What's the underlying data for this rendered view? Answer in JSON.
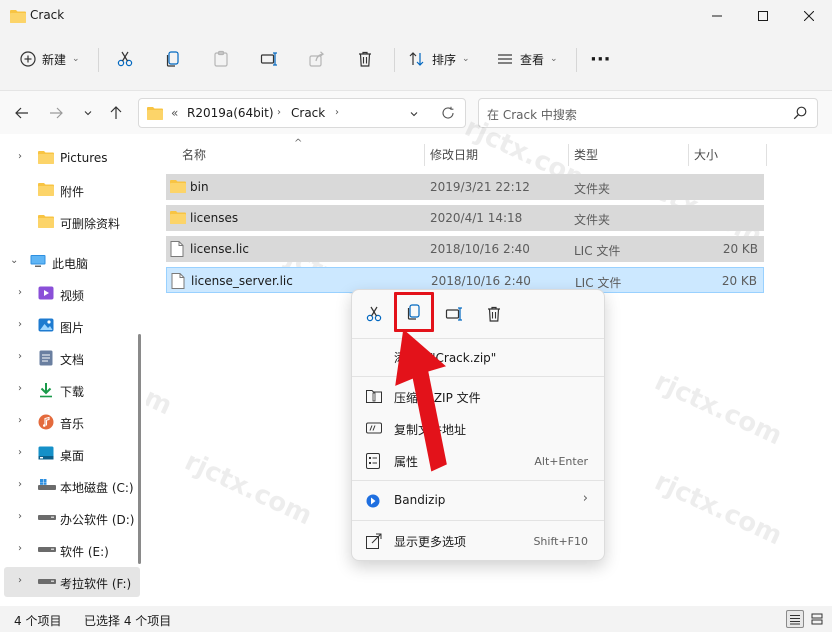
{
  "window": {
    "title": "Crack"
  },
  "command_bar": {
    "new_label": "新建",
    "sort_label": "排序",
    "view_label": "查看",
    "more_label": "···"
  },
  "address": {
    "overflow": "«",
    "crumbs": [
      "R2019a(64bit)",
      "Crack"
    ],
    "search_placeholder": "在 Crack 中搜索"
  },
  "sidebar": {
    "items": [
      {
        "label": "Pictures"
      },
      {
        "label": "附件"
      },
      {
        "label": "可删除资料"
      },
      {
        "label": "此电脑"
      },
      {
        "label": "视频"
      },
      {
        "label": "图片"
      },
      {
        "label": "文档"
      },
      {
        "label": "下载"
      },
      {
        "label": "音乐"
      },
      {
        "label": "桌面"
      },
      {
        "label": "本地磁盘 (C:)"
      },
      {
        "label": "办公软件 (D:)"
      },
      {
        "label": "软件 (E:)"
      },
      {
        "label": "考拉软件 (F:)"
      }
    ]
  },
  "columns": {
    "name": "名称",
    "date": "修改日期",
    "type": "类型",
    "size": "大小"
  },
  "files": [
    {
      "name": "bin",
      "date": "2019/3/21 22:12",
      "type": "文件夹",
      "size": ""
    },
    {
      "name": "licenses",
      "date": "2020/4/1 14:18",
      "type": "文件夹",
      "size": ""
    },
    {
      "name": "license.lic",
      "date": "2018/10/16 2:40",
      "type": "LIC 文件",
      "size": "20 KB"
    },
    {
      "name": "license_server.lic",
      "date": "2018/10/16 2:40",
      "type": "LIC 文件",
      "size": "20 KB"
    }
  ],
  "context_menu": {
    "add_to_zip": "添加到\"Crack.zip\"",
    "compress_zip": "压缩为 ZIP 文件",
    "copy_path": "复制文件地址",
    "properties": "属性",
    "properties_shortcut": "Alt+Enter",
    "bandizip": "Bandizip",
    "more_options": "显示更多选项",
    "more_options_shortcut": "Shift+F10"
  },
  "status": {
    "count": "4 个项目",
    "selected": "已选择 4 个项目"
  },
  "watermark": "rjctx.com",
  "colors": {
    "accent": "#0067c0",
    "highlight_box": "#e3121a",
    "folder": "#f8c443"
  }
}
